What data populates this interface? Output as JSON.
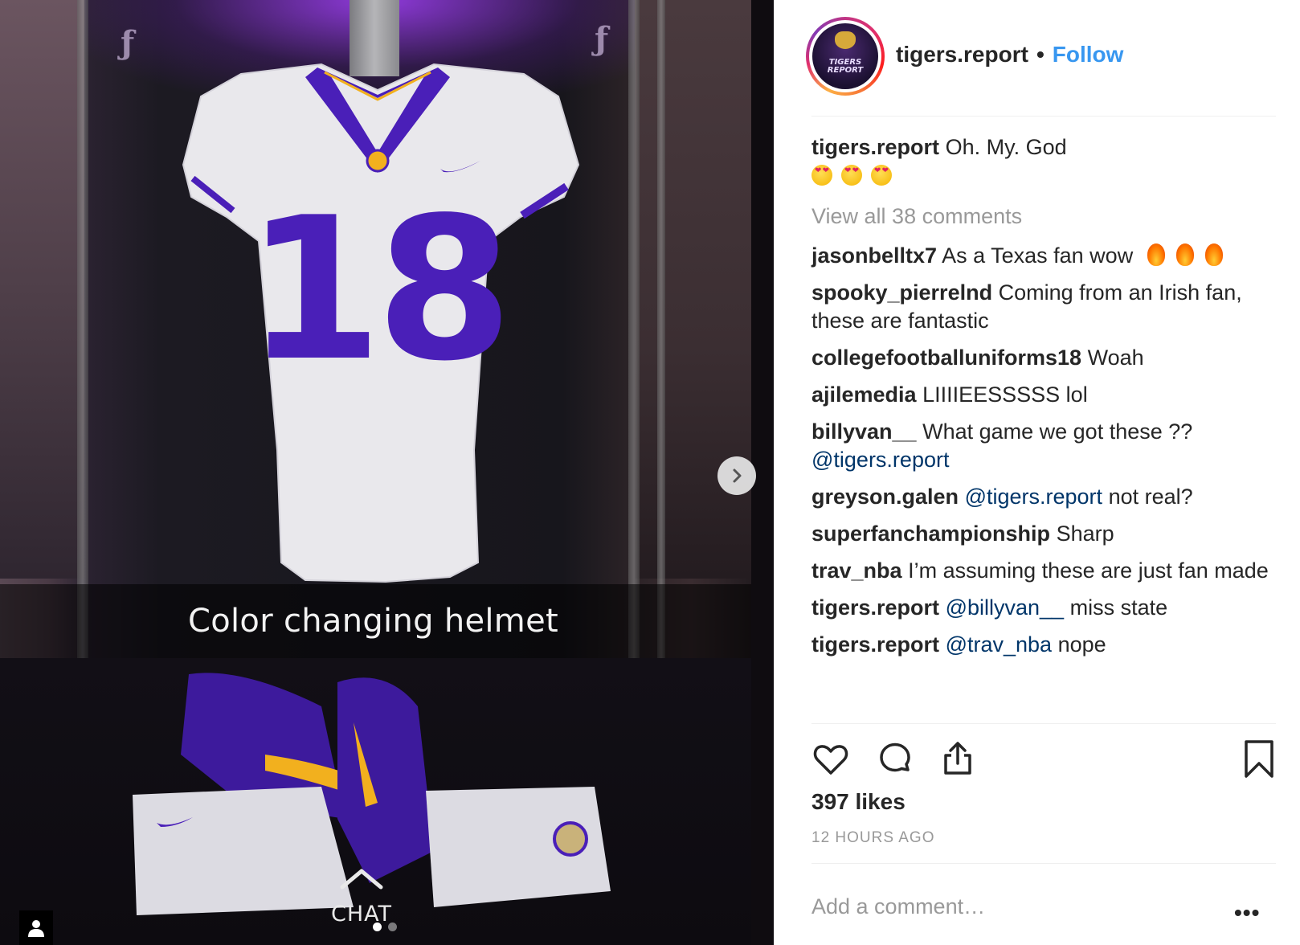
{
  "post": {
    "caption_overlay": "Color changing helmet",
    "chat_label": "CHAT",
    "jersey_number": "18"
  },
  "header": {
    "username": "tigers.report",
    "separator": "•",
    "follow_label": "Follow"
  },
  "caption": {
    "user": "tigers.report",
    "text": "Oh. My. God"
  },
  "view_all": "View all 38 comments",
  "comments": [
    {
      "user": "jasonbelltx7",
      "text": "As a Texas fan wow"
    },
    {
      "user": "spooky_pierrelnd",
      "text": "Coming from an Irish fan, these are fantastic"
    },
    {
      "user": "collegefootballuniforms18",
      "text": "Woah"
    },
    {
      "user": "ajilemedia",
      "text": "LIIIIEESSSSS lol"
    },
    {
      "user": "billyvan__",
      "text": "What game we got these ??",
      "mention": "@tigers.report"
    },
    {
      "user": "greyson.galen",
      "mention": "@tigers.report",
      "text": "not real?"
    },
    {
      "user": "superfanchampionship",
      "text": "Sharp"
    },
    {
      "user": "trav_nba",
      "text": "I’m assuming these are just fan made"
    },
    {
      "user": "tigers.report",
      "mention": "@billyvan__",
      "text": "miss state"
    },
    {
      "user": "tigers.report",
      "mention": "@trav_nba",
      "text": "nope"
    }
  ],
  "likes": "397 likes",
  "timestamp": "12 HOURS AGO",
  "add_comment_placeholder": "Add a comment…",
  "more_label": "•••",
  "icons": {
    "like": "heart-icon",
    "comment": "comment-bubble-icon",
    "share": "share-icon",
    "save": "bookmark-icon",
    "next": "chevron-right-icon",
    "profile": "person-icon"
  },
  "colors": {
    "follow": "#3897f0",
    "mention": "#003569",
    "muted": "#999999",
    "lsu_purple": "#4a1fb8",
    "lsu_gold": "#f2b01e"
  }
}
